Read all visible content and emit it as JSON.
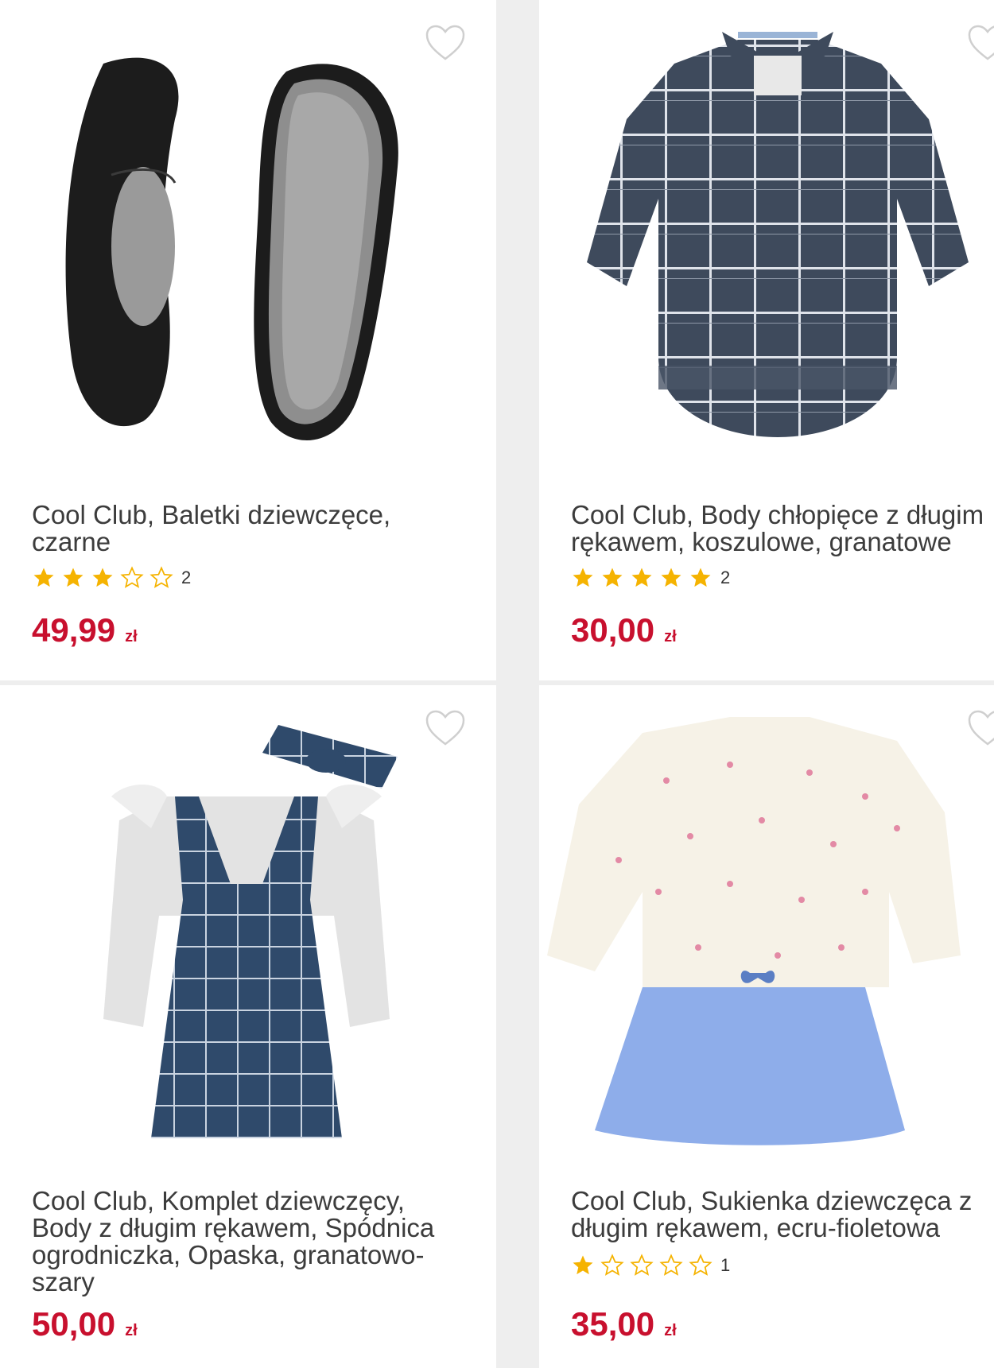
{
  "colors": {
    "price": "#c8102e",
    "star_filled": "#f5b301",
    "star_empty": "#f5b301",
    "heart": "#cfcfcf"
  },
  "products": [
    {
      "title": "Cool Club, Baletki dziewczęce, czarne",
      "rating": 3,
      "rating_count": "2",
      "price": "49,99",
      "currency": "zł",
      "image_icon": "ballet-shoes-image"
    },
    {
      "title": "Cool Club, Body chłopięce z długim rękawem, koszulowe, granatowe",
      "rating": 5,
      "rating_count": "2",
      "price": "30,00",
      "currency": "zł",
      "image_icon": "plaid-bodysuit-image"
    },
    {
      "title": "Cool Club, Komplet dziewczęcy, Body z długim rękawem, Spódnica ogrodniczka, Opaska, granatowo-szary",
      "rating": null,
      "rating_count": "",
      "price": "50,00",
      "currency": "zł",
      "image_icon": "pinafore-set-image"
    },
    {
      "title": "Cool Club, Sukienka dziewczęca z długim rękawem, ecru-fioletowa",
      "rating": 1,
      "rating_count": "1",
      "price": "35,00",
      "currency": "zł",
      "image_icon": "sweater-dress-image"
    }
  ]
}
